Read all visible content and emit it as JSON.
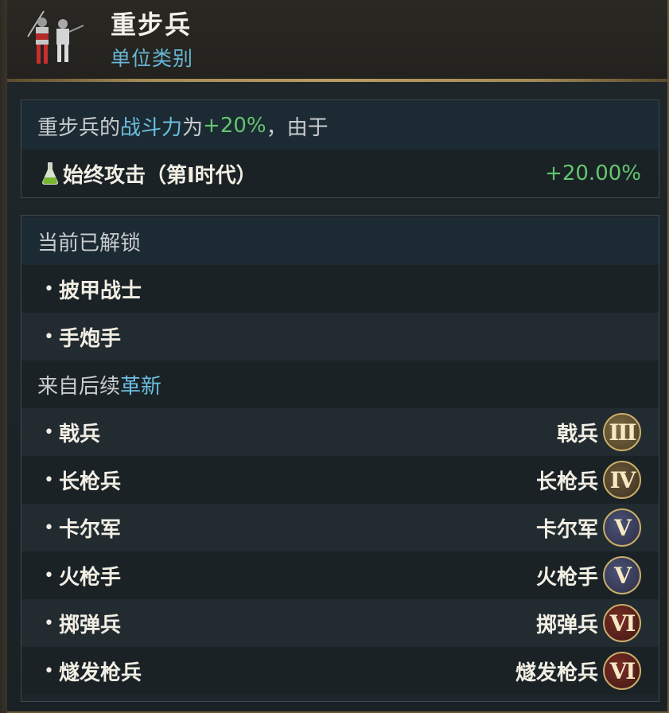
{
  "header": {
    "title": "重步兵",
    "subtitle": "单位类别"
  },
  "combat": {
    "prefix": "重步兵的",
    "highlight": "战斗力",
    "middle": "为",
    "value": "+20%",
    "suffix": "，由于",
    "source_label": "始终攻击（第I时代）",
    "source_value": "+20.00%",
    "source_icon": "flask-icon"
  },
  "unlocked": {
    "heading": "当前已解锁",
    "items": [
      "披甲战士",
      "手炮手"
    ]
  },
  "future": {
    "heading_prefix": "来自后续",
    "heading_highlight": "革新",
    "items": [
      {
        "name": "戟兵",
        "era_label": "戟兵",
        "numeral": "III"
      },
      {
        "name": "长枪兵",
        "era_label": "长枪兵",
        "numeral": "IV"
      },
      {
        "name": "卡尔军",
        "era_label": "卡尔军",
        "numeral": "V"
      },
      {
        "name": "火枪手",
        "era_label": "火枪手",
        "numeral": "V"
      },
      {
        "name": "掷弹兵",
        "era_label": "掷弹兵",
        "numeral": "VI"
      },
      {
        "name": "燧发枪兵",
        "era_label": "燧发枪兵",
        "numeral": "VI"
      }
    ]
  },
  "colors": {
    "accent_blue": "#6bbfe0",
    "positive_green": "#62c66e",
    "gold_border": "#b89c62"
  }
}
